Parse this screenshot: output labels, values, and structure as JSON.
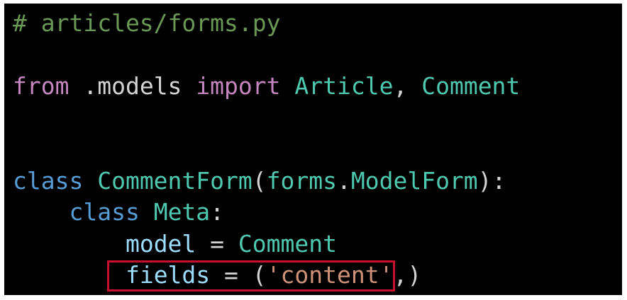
{
  "code": {
    "line1": {
      "comment": "# articles/forms.py"
    },
    "line2": {
      "from_kw": "from",
      "module": " .models ",
      "import_kw": "import",
      "class1": " Article",
      "comma": ", ",
      "class2": "Comment"
    },
    "line3": {
      "class_kw": "class",
      "class_name": " CommentForm",
      "paren_open": "(",
      "module": "forms",
      "dot": ".",
      "base": "ModelForm",
      "paren_close": "):"
    },
    "line4": {
      "indent": "    ",
      "class_kw": "class",
      "class_name": " Meta",
      "colon": ":"
    },
    "line5": {
      "indent": "        ",
      "ident": "model",
      "eq": " = ",
      "value": "Comment"
    },
    "line6": {
      "indent": "        ",
      "ident": "fields",
      "eq": " = ",
      "paren_open": "(",
      "str": "'content'",
      "rest": ",)"
    }
  },
  "colors": {
    "background": "#000000",
    "highlight_border": "#c8102e",
    "comment": "#6a9955",
    "keyword_control": "#c586c0",
    "keyword": "#569cd6",
    "class_name": "#4ec9b0",
    "identifier": "#9cdcfe",
    "string": "#ce9178"
  }
}
